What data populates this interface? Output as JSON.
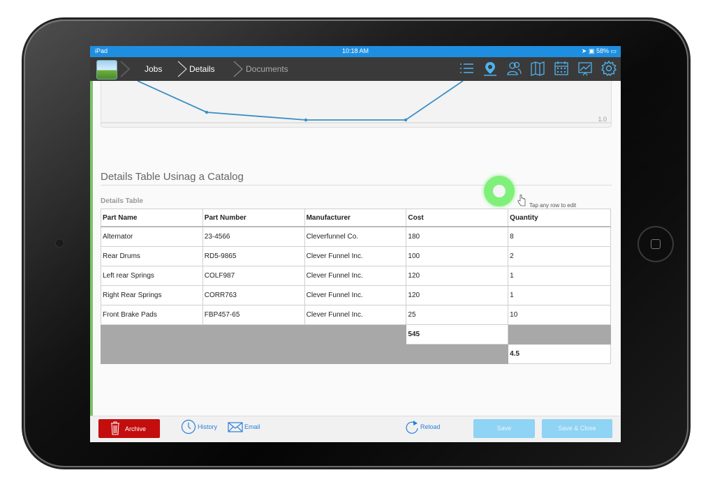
{
  "status": {
    "device": "iPad",
    "time": "10:18 AM",
    "battery": "58%"
  },
  "nav": {
    "breadcrumbs": [
      {
        "label": "Jobs",
        "active": true
      },
      {
        "label": "Details",
        "active": true
      },
      {
        "label": "Documents",
        "active": false
      }
    ],
    "icons": [
      "list-icon",
      "map-pin-icon",
      "people-icon",
      "map-icon",
      "calendar-icon",
      "chart-icon",
      "gear-icon"
    ]
  },
  "chart": {
    "tick_label": "1.0"
  },
  "section": {
    "title": "Details Table Usinag a Catalog",
    "table_caption": "Details Table",
    "edit_hint": "Tap any row to edit"
  },
  "table": {
    "headers": [
      "Part Name",
      "Part Number",
      "Manufacturer",
      "Cost",
      "Quantity"
    ],
    "rows": [
      [
        "Alternator",
        "23-4566",
        "Cleverfunnel Co.",
        "180",
        "8"
      ],
      [
        "Rear Drums",
        "RD5-9865",
        "Clever Funnel Inc.",
        "100",
        "2"
      ],
      [
        "Left rear Springs",
        "COLF987",
        "Clever Funnel Inc.",
        "120",
        "1"
      ],
      [
        "Right Rear Springs",
        "CORR763",
        "Clever Funnel Inc.",
        "120",
        "1"
      ],
      [
        "Front Brake Pads",
        "FBP457-65",
        "Clever Funnel Inc.",
        "25",
        "10"
      ]
    ],
    "cost_total": "545",
    "quantity_total": "4.5"
  },
  "toolbar": {
    "archive": "Archive",
    "history": "History",
    "email": "Email",
    "reload": "Reload",
    "save": "Save",
    "save_close": "Save & Close"
  },
  "colors": {
    "accent": "#1e8fe0",
    "archive": "#c40d0d",
    "touch": "#7ff07a"
  }
}
